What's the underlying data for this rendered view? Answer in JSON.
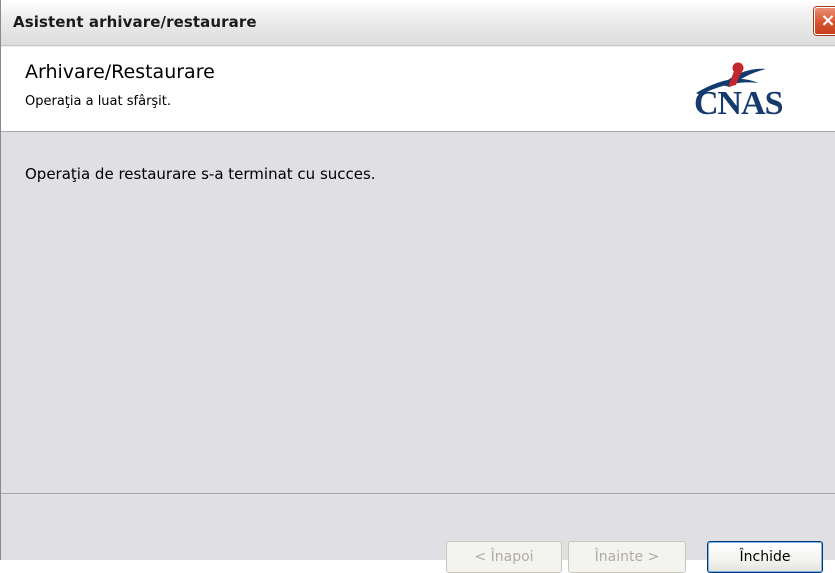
{
  "window": {
    "title": "Asistent arhivare/restaurare",
    "close_icon_glyph": "×",
    "icons": [
      "close-icon",
      "cnas-logo-icon"
    ]
  },
  "header": {
    "title": "Arhivare/Restaurare",
    "subtitle": "Operaţia a luat sfârşit.",
    "logo_text": "CNAS"
  },
  "main": {
    "message": "Operaţia de restaurare s-a terminat cu succes."
  },
  "footer": {
    "back_label": "< Înapoi",
    "next_label": "Înainte >",
    "close_label": "Închide"
  },
  "colors": {
    "logo_blue": "#143a6e",
    "logo_red": "#c0282d",
    "close_red": "#d8532f"
  }
}
